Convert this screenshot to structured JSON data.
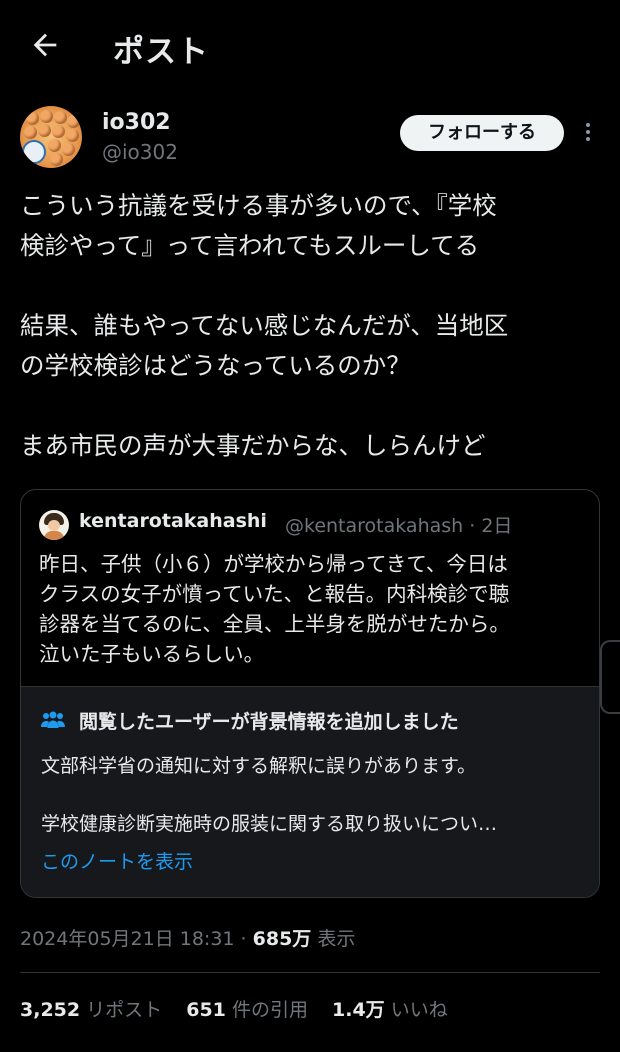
{
  "header": {
    "title": "ポスト"
  },
  "author": {
    "name": "io302",
    "handle": "@io302",
    "follow_label": "フォローする"
  },
  "post": {
    "lines": [
      "こういう抗議を受ける事が多いので、『学校",
      "検診やって』って言われてもスルーしてる",
      "",
      "結果、誰もやってない感じなんだが、当地区",
      "の学校検診はどうなっているのか？",
      "",
      "まあ市民の声が大事だからな、しらんけど"
    ]
  },
  "quote": {
    "name": "kentarotakahashi",
    "handle_time": "@kentarotakahash · 2日",
    "lines": [
      "昨日、子供（小６）が学校から帰ってきて、今日は",
      "クラスの女子が憤っていた、と報告。内科検診で聴",
      "診器を当てるのに、全員、上半身を脱がせたから。",
      "泣いた子もいるらしい。"
    ]
  },
  "community_note": {
    "title": "閲覧したユーザーが背景情報を追加しました",
    "lines": [
      "文部科学省の通知に対する解釈に誤りがあります。",
      "",
      "学校健康診断実施時の服装に関する取り扱いについ…"
    ],
    "link": "このノートを表示"
  },
  "meta": {
    "datetime": "2024年05月21日 18:31",
    "sep": " · ",
    "views": "685万",
    "views_label": " 表示"
  },
  "stats": {
    "reposts": "3,252",
    "reposts_label": "リポスト",
    "quotes": "651",
    "quotes_label": "件の引用",
    "likes": "1.4万",
    "likes_label": "いいね"
  },
  "colors": {
    "background": "#000000",
    "text": "#e7e9ea",
    "muted": "#71767b",
    "link": "#1d9bf0",
    "note_bg": "#16181c"
  },
  "icons": {
    "back": "arrow-left-icon",
    "more": "more-vertical-icon",
    "note": "people-icon"
  }
}
